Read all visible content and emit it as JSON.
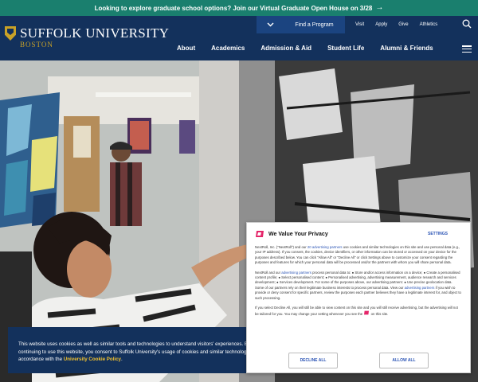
{
  "promo": {
    "text": "Looking to explore graduate school options? Join our Virtual Graduate Open House on 3/28",
    "arrow": "→"
  },
  "header": {
    "logo_name": "SUFFOLK UNIVERSITY",
    "logo_city": "BOSTON",
    "utility_links": [
      "Visit",
      "Apply",
      "Give",
      "Athletics"
    ],
    "find_program": "Find a Program",
    "nav": [
      "About",
      "Academics",
      "Admission & Aid",
      "Student Life",
      "Alumni & Friends"
    ]
  },
  "cookie_banner": {
    "text": "This website uses cookies as well as similar tools and technologies to understand visitors' experiences. By continuing to use this website, you consent to Suffolk University's usage of cookies and similar technologies in accordance with the",
    "link": "University Cookie Policy",
    "end": "."
  },
  "privacy_modal": {
    "title": "We Value Your Privacy",
    "settings": "SETTINGS",
    "p1_a": "NextRoll, Inc. (\"NextRoll\") and our",
    "p1_link": "20 advertising partners",
    "p1_b": "use cookies and similar technologies on this site and use personal data (e.g., your IP address). If you consent, the cookies, device identifiers, or other information can be stored or accessed on your device for the purposes described below. You can click \"Allow All\" or \"Decline All\" or click Settings above to customize your consent regarding the purposes and features for which your personal data will be processed and/or the partners with whom you will share personal data.",
    "p2_a": "NextRoll and our",
    "p2_link1": "advertising partners",
    "p2_b": "process personal data to: ● Store and/or access information on a device; ● Create a personalised content profile; ● Select personalised content; ● Personalised advertising, advertising measurement, audience research and services development; ● Services development. For some of the purposes above, our advertising partners: ● Use precise geolocation data. Some of our partners rely on their legitimate business interests to process personal data. View our",
    "p2_link2": "advertising partners",
    "p2_c": "if you wish to provide or deny consent for specific partners, review the purposes each partner believes they have a legitimate interest for, and object to such processing.",
    "p3": "If you select Decline All, you will still be able to view content on this site and you will still receive advertising, but the advertising will not be tailored for you. You may change your setting whenever you see the",
    "p3_end": "on this site.",
    "decline": "DECLINE ALL",
    "allow": "ALLOW ALL"
  },
  "colors": {
    "promo_bg": "#1a7f6e",
    "header_bg": "#13315c",
    "gold": "#c9a227",
    "link_blue": "#2b54b5",
    "brand_red": "#e5266a"
  }
}
